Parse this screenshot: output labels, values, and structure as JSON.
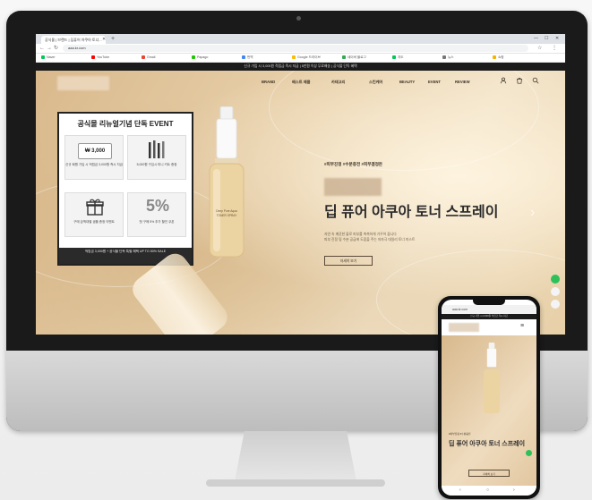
{
  "browser": {
    "tab_title": "공식몰 | 브랜드 | 딥퓨어 아쿠아 토너...",
    "url": "aaa.kr.com",
    "bookmarks": [
      "Naver",
      "YouTube",
      "Gmail",
      "Papago",
      "번역",
      "Google 드라이브",
      "네이버 블로그",
      "지도",
      "뉴스",
      "쇼핑"
    ]
  },
  "site": {
    "announcement": "신규 가입 시 3,000원 적립금 즉시 지급 | 5만원 이상 무료배송 | 공식몰 단독 혜택",
    "menu": [
      "BRAND",
      "베스트 제품",
      "카테고리",
      "스킨케어",
      "BEAUTY",
      "EVENT",
      "REVIEW"
    ],
    "event": {
      "title": "공식몰 리뉴얼기념 단독 EVENT",
      "coupon_value": "₩ 3,000",
      "cells": [
        {
          "caption": "신규 회원 가입 시 적립금 3,000원 즉시 지급"
        },
        {
          "caption": "5,000원 구입시 미니 키트 증정"
        },
        {
          "caption": "구매 금액대별 샘플 증정 이벤트"
        },
        {
          "caption": "첫 구매 5% 추가 할인 쿠폰"
        }
      ],
      "percent": "5%",
      "footer": "적립금 3,000원 + 공식몰 단독 특별 혜택 UP TO 50% SALE"
    },
    "hero": {
      "subline": "#피부진정 #수분충전 #피부결정돈",
      "headline": "딥 퓨어 아쿠아 토너 스프레이",
      "desc": [
        "자연 속 깨끗한 물로 피부를 촉촉하게 가꾸어 줍니다",
        "피부 진정 및 수분 공급에 도움을 주는 저자극 데일리 토너 미스트"
      ],
      "button": "자세히 보기",
      "bottle_label": [
        "Deep Pure Aqua",
        "TONER SPRAY"
      ]
    }
  },
  "mobile": {
    "url": "aaa.kr.com",
    "announcement": "신규 가입 시 3,000원 적립금 즉시 지급",
    "subline": "#피부진정 #수분충전",
    "headline": "딥 퓨어 아쿠아 토너 스프레이",
    "button": "자세히 보기"
  }
}
